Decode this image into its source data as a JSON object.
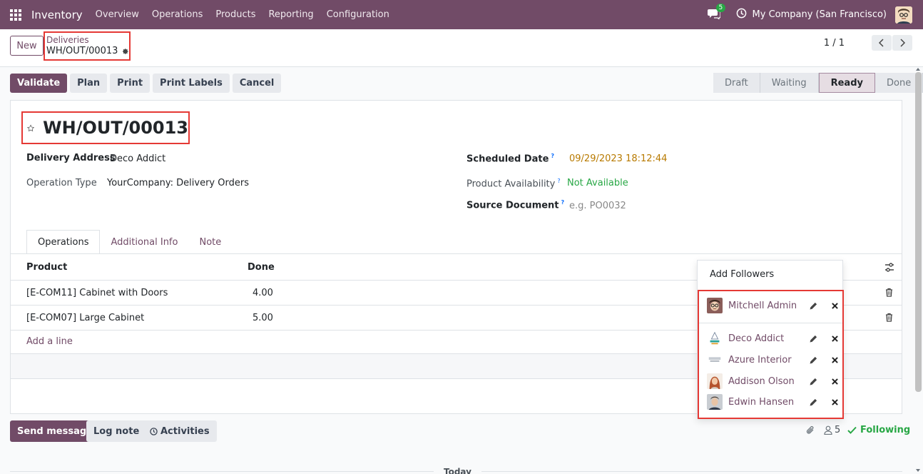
{
  "navbar": {
    "app_name": "Inventory",
    "menus": [
      "Overview",
      "Operations",
      "Products",
      "Reporting",
      "Configuration"
    ],
    "chat_badge": "5",
    "company": "My Company (San Francisco)"
  },
  "control_panel": {
    "new_label": "New",
    "breadcrumb_parent": "Deliveries",
    "breadcrumb_current": "WH/OUT/00013",
    "pager": "1 / 1"
  },
  "actions": {
    "validate": "Validate",
    "plan": "Plan",
    "print": "Print",
    "print_labels": "Print Labels",
    "cancel": "Cancel"
  },
  "status": {
    "steps": [
      "Draft",
      "Waiting",
      "Ready",
      "Done"
    ],
    "current": "Ready"
  },
  "record": {
    "title": "WH/OUT/00013",
    "delivery_address_label": "Delivery Address",
    "delivery_address": "Deco Addict",
    "operation_type_label": "Operation Type",
    "operation_type": "YourCompany: Delivery Orders",
    "scheduled_date_label": "Scheduled Date",
    "scheduled_date": "09/29/2023 18:12:44",
    "availability_label": "Product Availability",
    "availability": "Not Available",
    "source_doc_label": "Source Document",
    "source_doc_placeholder": "e.g. PO0032",
    "help_mark": "?"
  },
  "tabs": [
    "Operations",
    "Additional Info",
    "Note"
  ],
  "table": {
    "columns": [
      "Product",
      "Done"
    ],
    "rows": [
      {
        "product": "[E-COM11] Cabinet with Doors",
        "done": "4.00"
      },
      {
        "product": "[E-COM07] Large Cabinet",
        "done": "5.00"
      }
    ],
    "add_line": "Add a line"
  },
  "chatter": {
    "send_message": "Send message",
    "log_note": "Log note",
    "activities": "Activities",
    "followers_count": "5",
    "following": "Following",
    "today": "Today"
  },
  "followers_dropdown": {
    "add_followers": "Add Followers",
    "followers": [
      {
        "name": "Mitchell Admin"
      },
      {
        "name": "Deco Addict"
      },
      {
        "name": "Azure Interior"
      },
      {
        "name": "Addison Olson"
      },
      {
        "name": "Edwin Hansen"
      }
    ]
  },
  "colors": {
    "brand": "#714b67",
    "highlight": "#e53935",
    "success": "#28a745",
    "warning": "#b87a00"
  }
}
